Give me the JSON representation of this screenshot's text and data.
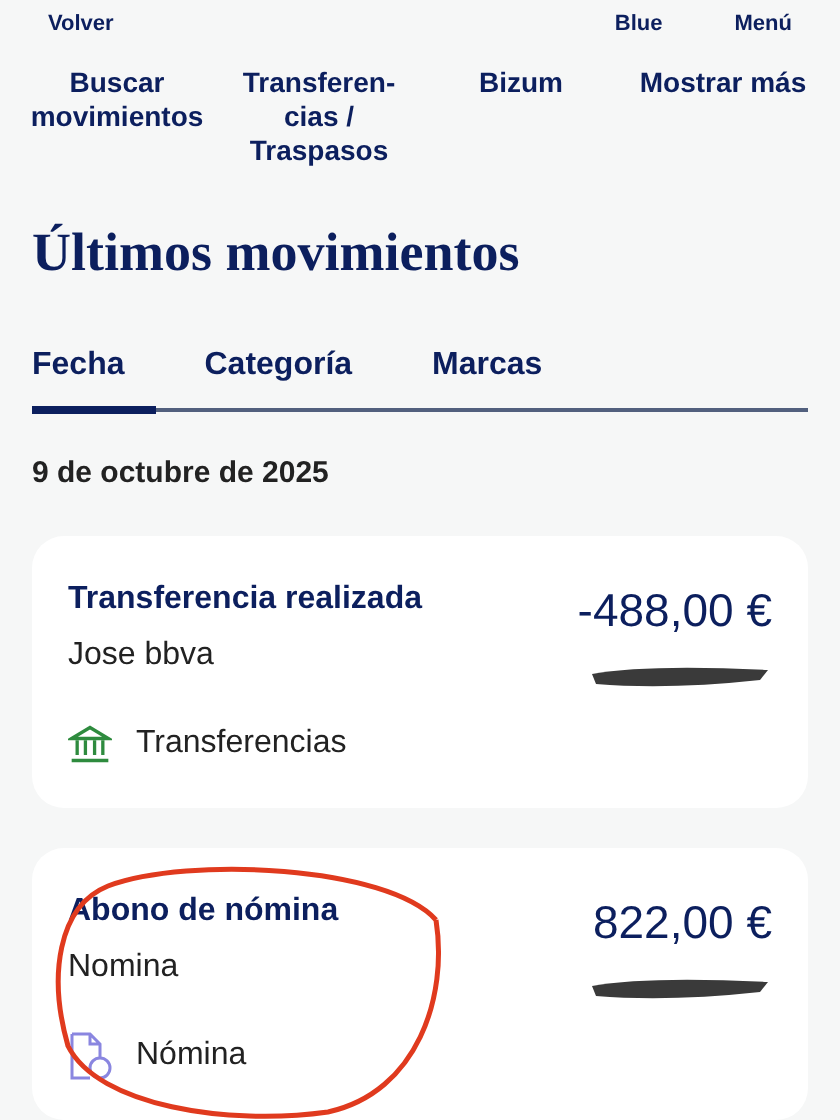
{
  "top_bar": {
    "back": "Volver",
    "right": [
      "Blue",
      "Menú"
    ]
  },
  "quick_actions": [
    "Buscar movimientos",
    "Transferen-\ncias /\nTraspasos",
    "Bizum",
    "Mostrar más"
  ],
  "title": "Últimos movimientos",
  "tabs": [
    {
      "label": "Fecha",
      "selected": true
    },
    {
      "label": "Categoría",
      "selected": false
    },
    {
      "label": "Marcas",
      "selected": false
    }
  ],
  "date": "9 de octubre de 2025",
  "movements": [
    {
      "title": "Transferencia realizada",
      "subtitle": "Jose bbva",
      "amount": "-488,00 €",
      "category": {
        "kind": "bank",
        "label": "Transferencias"
      },
      "annotated": false
    },
    {
      "title": "Abono de nómina",
      "subtitle": "Nomina",
      "amount": "822,00 €",
      "category": {
        "kind": "payroll",
        "label": "Nómina"
      },
      "annotated": true
    }
  ]
}
